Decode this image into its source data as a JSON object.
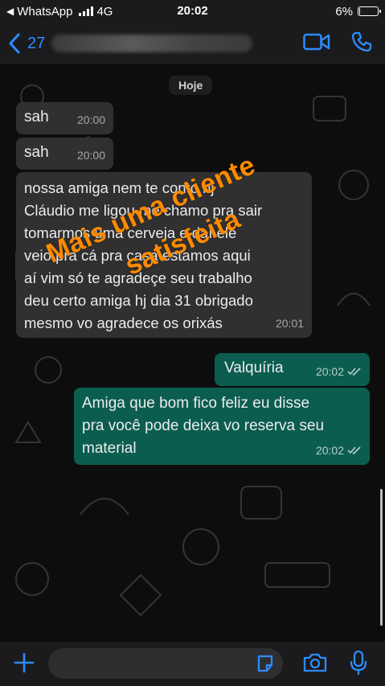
{
  "status_bar": {
    "back_app": "WhatsApp",
    "network": "4G",
    "time": "20:02",
    "battery_percent": "6%",
    "battery_level": 0.06
  },
  "header": {
    "back_count": "27"
  },
  "chat": {
    "date_label": "Hoje",
    "messages": [
      {
        "direction": "incoming",
        "text": "sah",
        "time": "20:00"
      },
      {
        "direction": "incoming",
        "text": "sah",
        "time": "20:00"
      },
      {
        "direction": "incoming",
        "text": "nossa amiga nem te conto hj\nCláudio me ligou me chamo pra sair\ntomarmos uma cerveja e daí ele\nveio pra cá pra casa estamos aqui\naí vim só te agradeçe seu trabalho\ndeu certo amiga hj dia 31 obrigado\nmesmo vo agradece os orixás",
        "time": "20:01"
      },
      {
        "direction": "outgoing",
        "text": "Valquíria",
        "time": "20:02",
        "read": true
      },
      {
        "direction": "outgoing",
        "text": "Amiga que bom fico feliz eu disse\npra você pode deixa vo reserva seu\nmaterial",
        "time": "20:02",
        "read": true
      }
    ],
    "overlay_lines": [
      "Mais uma cliente",
      "satisfeita"
    ]
  },
  "colors": {
    "accent": "#2d8cff",
    "incoming_bubble": "#303030",
    "outgoing_bubble": "#0b5d4f",
    "overlay_text": "#ff8a00"
  },
  "icons": [
    "chevron-left-icon",
    "video-call-icon",
    "phone-icon",
    "plus-icon",
    "sticker-icon",
    "camera-icon",
    "microphone-icon",
    "double-check-icon"
  ]
}
